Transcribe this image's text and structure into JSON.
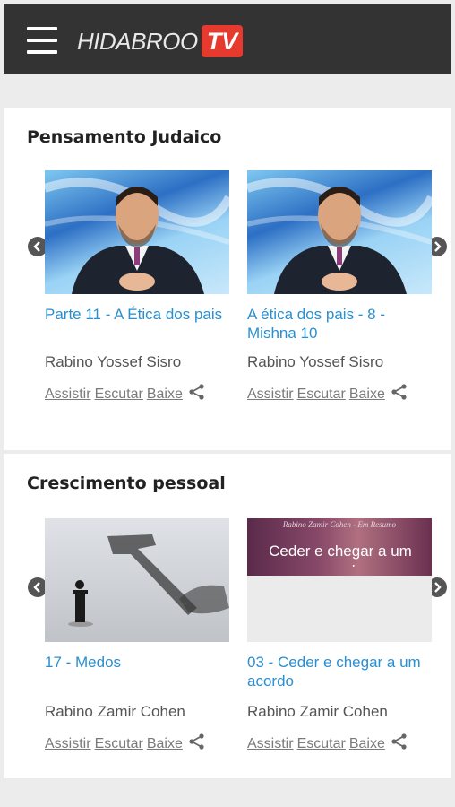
{
  "app": {
    "logo_text": "HIDABROO",
    "logo_badge": "TV"
  },
  "sections": [
    {
      "title": "Pensamento Judaico",
      "cards": [
        {
          "title": "Parte 11 - A Ética dos pais",
          "author": "Rabino Yossef Sisro"
        },
        {
          "title": "A ética dos pais - 8 - Mishna 10",
          "author": "Rabino Yossef Sisro"
        }
      ]
    },
    {
      "title": "Crescimento pessoal",
      "cards": [
        {
          "title": "17 - Medos",
          "author": "Rabino Zamir Cohen"
        },
        {
          "title": "03 - Ceder e chegar a um acordo",
          "author": "Rabino Zamir Cohen",
          "thumb_caption_top": "Rabino Zamir Cohen - Em Resumo",
          "thumb_caption_main": "Ceder e chegar a um acordo"
        }
      ]
    }
  ],
  "actions": {
    "watch": "Assistir",
    "listen": "Escutar",
    "download": "Baixe"
  },
  "colors": {
    "header_bg": "#333333",
    "accent_red": "#e63a2e",
    "link_blue": "#2a8fd1"
  },
  "icons": [
    "menu-icon",
    "share-icon",
    "chevron-left-icon",
    "chevron-right-icon"
  ]
}
